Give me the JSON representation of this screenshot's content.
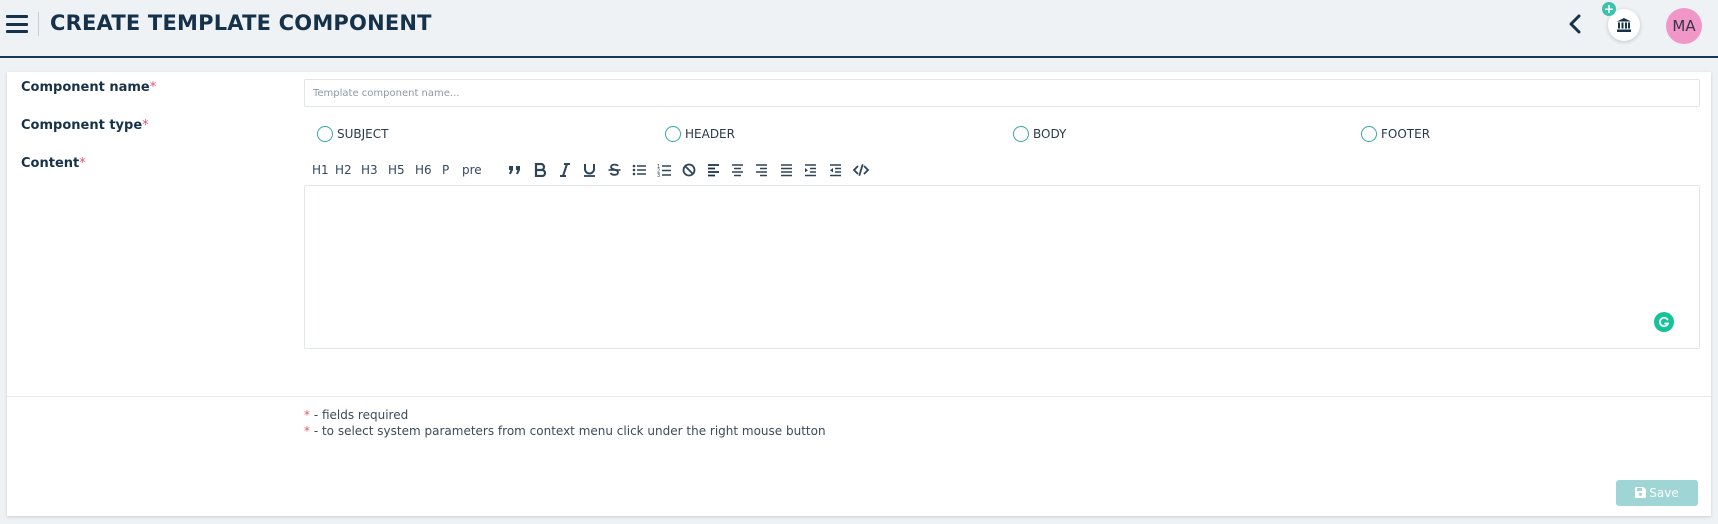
{
  "header": {
    "title": "CREATE TEMPLATE COMPONENT",
    "avatar_initials": "MA",
    "bank_badge": "+"
  },
  "form": {
    "name": {
      "label": "Component name",
      "required_mark": "*",
      "placeholder": "Template component name...",
      "value": ""
    },
    "type": {
      "label": "Component type",
      "required_mark": "*",
      "options": [
        "SUBJECT",
        "HEADER",
        "BODY",
        "FOOTER"
      ],
      "selected": null
    },
    "content": {
      "label": "Content",
      "required_mark": "*",
      "toolbar_text": [
        "H1",
        "H2",
        "H3",
        "H5",
        "H6",
        "P",
        "pre"
      ],
      "toolbar_icons": [
        "quote-icon",
        "bold-icon",
        "italic-icon",
        "underline-icon",
        "strikethrough-icon",
        "bullet-list-icon",
        "numbered-list-icon",
        "clear-format-icon",
        "align-left-icon",
        "align-center-icon",
        "align-right-icon",
        "align-justify-icon",
        "indent-icon",
        "outdent-icon",
        "code-view-icon"
      ],
      "value": ""
    }
  },
  "notes": {
    "mark": "*",
    "required": "- fields required",
    "context_menu": "- to select system parameters from context menu click under the right mouse button"
  },
  "actions": {
    "save_label": "Save"
  },
  "colors": {
    "accent": "#3aa6a8",
    "required": "#e5556c",
    "title": "#16324a",
    "save_bg": "#9fd6d5",
    "avatar_bg": "#f097c8"
  }
}
